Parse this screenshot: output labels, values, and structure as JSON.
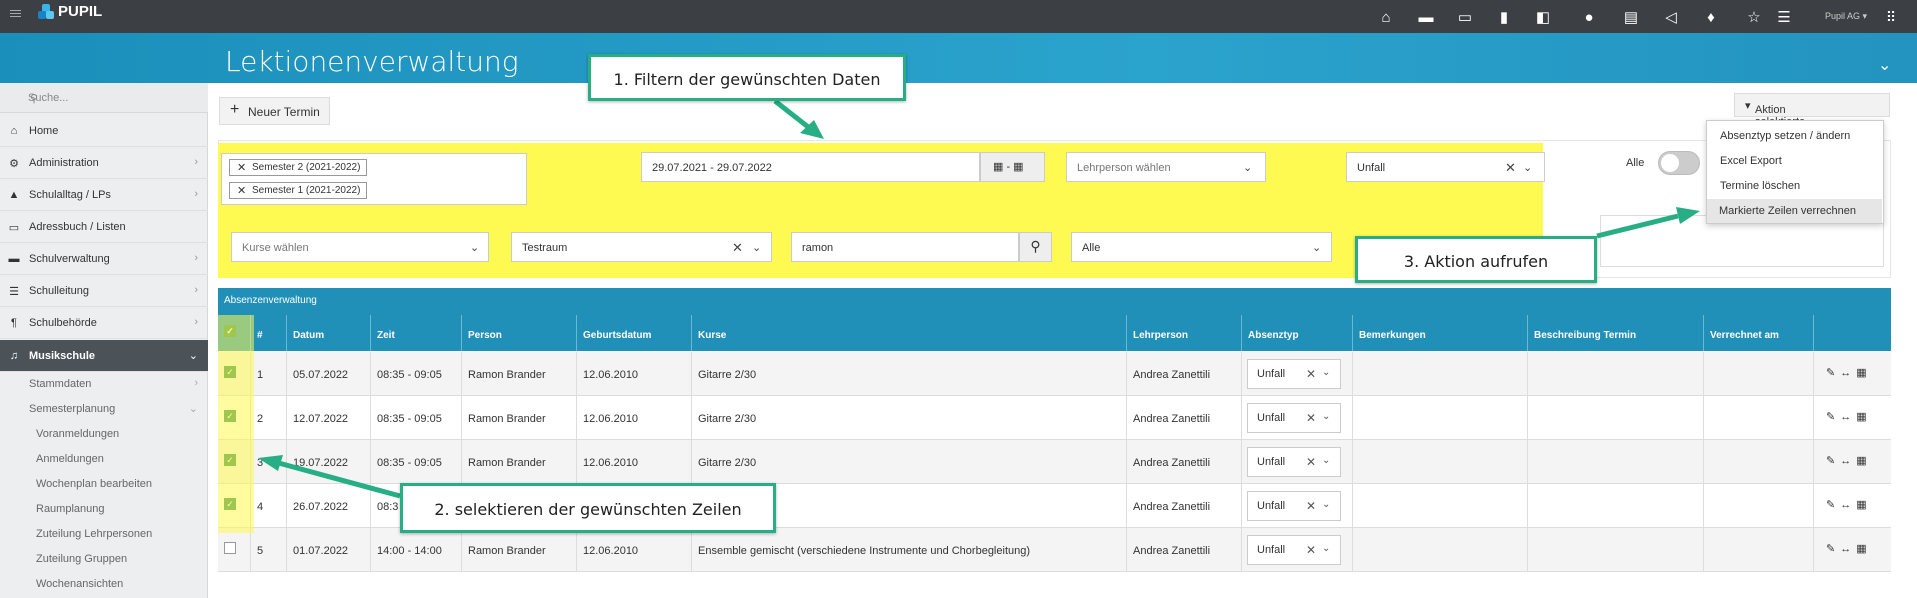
{
  "topbar": {
    "logo": "PUPIL",
    "user": "Pupil AG",
    "icons": [
      "home-icon",
      "folder-icon",
      "id-card-icon",
      "office-icon",
      "outlook-icon",
      "chat-icon",
      "book-icon",
      "megaphone-icon",
      "bulb-icon",
      "star-icon",
      "sliders-icon",
      "apps-grid-icon"
    ]
  },
  "page": {
    "title": "Lektionenverwaltung"
  },
  "sidebar": {
    "search_placeholder": "Suche...",
    "items": [
      {
        "label": "Home",
        "icon": "home-icon"
      },
      {
        "label": "Administration",
        "icon": "cogs-icon"
      },
      {
        "label": "Schulalltag / LPs",
        "icon": "graduation-cap-icon"
      },
      {
        "label": "Adressbuch / Listen",
        "icon": "address-card-icon"
      },
      {
        "label": "Schulverwaltung",
        "icon": "folder-icon"
      },
      {
        "label": "Schulleitung",
        "icon": "signpost-icon"
      },
      {
        "label": "Schulbehörde",
        "icon": "paragraph-icon"
      },
      {
        "label": "Musikschule",
        "icon": "music-icon"
      }
    ],
    "sub": [
      "Stammdaten",
      "Semesterplanung"
    ],
    "subsub": [
      "Voranmeldungen",
      "Anmeldungen",
      "Wochenplan bearbeiten",
      "Raumplanung",
      "Zuteilung Lehrpersonen",
      "Zuteilung Gruppen",
      "Wochenansichten"
    ]
  },
  "toolbar": {
    "new_label": "Neuer Termin",
    "action_label": "Aktion selektierte Daten"
  },
  "dropdown": {
    "items": [
      "Absenztyp setzen / ändern",
      "Excel Export",
      "Termine löschen",
      "Markierte Zeilen verrechnen"
    ]
  },
  "filters": {
    "semesters": [
      "Semester 2 (2021-2022)",
      "Semester 1 (2021-2022)"
    ],
    "date_range": "29.07.2021 - 29.07.2022",
    "teacher_placeholder": "Lehrperson wählen",
    "absence_type": "Unfall",
    "all_label": "Alle",
    "course_placeholder": "Kurse wählen",
    "room": "Testraum",
    "search_value": "ramon",
    "scope": "Alle"
  },
  "table": {
    "title": "Absenzenverwaltung",
    "headers": [
      "#",
      "Datum",
      "Zeit",
      "Person",
      "Geburtsdatum",
      "Kurse",
      "Lehrperson",
      "Absenztyp",
      "Bemerkungen",
      "Beschreibung Termin",
      "Verrechnet am"
    ],
    "rows": [
      {
        "n": "1",
        "date": "05.07.2022",
        "time": "08:35 - 09:05",
        "person": "Ramon Brander",
        "birth": "12.06.2010",
        "course": "Gitarre 2/30",
        "teacher": "Andrea Zanettili",
        "type": "Unfall",
        "checked": true
      },
      {
        "n": "2",
        "date": "12.07.2022",
        "time": "08:35 - 09:05",
        "person": "Ramon Brander",
        "birth": "12.06.2010",
        "course": "Gitarre 2/30",
        "teacher": "Andrea Zanettili",
        "type": "Unfall",
        "checked": true
      },
      {
        "n": "3",
        "date": "19.07.2022",
        "time": "08:35 - 09:05",
        "person": "Ramon Brander",
        "birth": "12.06.2010",
        "course": "Gitarre 2/30",
        "teacher": "Andrea Zanettili",
        "type": "Unfall",
        "checked": true
      },
      {
        "n": "4",
        "date": "26.07.2022",
        "time": "08:3",
        "person": "",
        "birth": "",
        "course": "",
        "teacher": "Andrea Zanettili",
        "type": "Unfall",
        "checked": true
      },
      {
        "n": "5",
        "date": "01.07.2022",
        "time": "14:00 - 14:00",
        "person": "Ramon Brander",
        "birth": "12.06.2010",
        "course": "Ensemble gemischt (verschiedene Instrumente und Chorbegleitung)",
        "teacher": "Andrea Zanettili",
        "type": "Unfall",
        "checked": false
      }
    ]
  },
  "callouts": {
    "c1": "1. Filtern der gewünschten Daten",
    "c2": "2. selektieren der gewünschten Zeilen",
    "c3": "3. Aktion aufrufen"
  },
  "colors": {
    "header_blue": "#2190b8",
    "highlight_yellow": "#fffa52",
    "callout_green": "#27ae84"
  }
}
